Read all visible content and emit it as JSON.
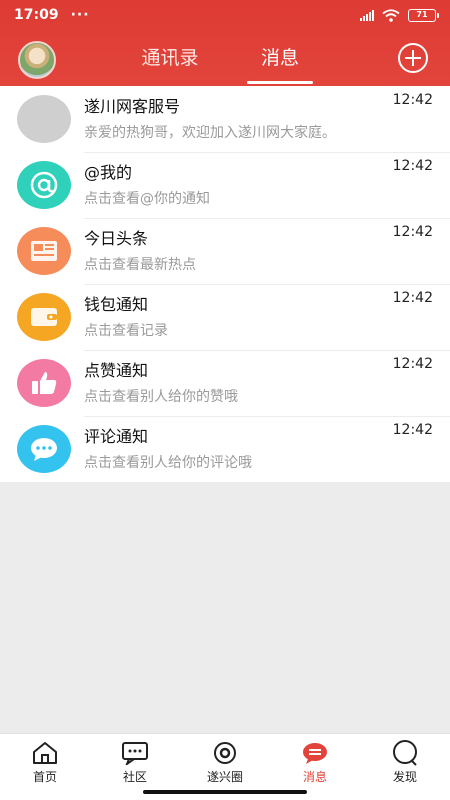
{
  "status_bar": {
    "time": "17:09",
    "dots": "···",
    "battery": "71"
  },
  "header": {
    "tabs": [
      {
        "label": "通讯录",
        "active": false
      },
      {
        "label": "消息",
        "active": true
      }
    ]
  },
  "messages": [
    {
      "title": "遂川网客服号",
      "subtitle": "亲爱的热狗哥，欢迎加入遂川网大家庭。",
      "time": "12:42",
      "icon": "avatar-placeholder"
    },
    {
      "title": "@我的",
      "subtitle": "点击查看@你的通知",
      "time": "12:42",
      "icon": "at-icon"
    },
    {
      "title": "今日头条",
      "subtitle": "点击查看最新热点",
      "time": "12:42",
      "icon": "newspaper-icon"
    },
    {
      "title": "钱包通知",
      "subtitle": "点击查看记录",
      "time": "12:42",
      "icon": "wallet-icon"
    },
    {
      "title": "点赞通知",
      "subtitle": "点击查看别人给你的赞哦",
      "time": "12:42",
      "icon": "thumbs-up-icon"
    },
    {
      "title": "评论通知",
      "subtitle": "点击查看别人给你的评论哦",
      "time": "12:42",
      "icon": "comment-icon"
    }
  ],
  "bottom_nav": [
    {
      "label": "首页",
      "icon": "home-icon",
      "active": false
    },
    {
      "label": "社区",
      "icon": "community-icon",
      "active": false
    },
    {
      "label": "遂兴圈",
      "icon": "circle-icon",
      "active": false
    },
    {
      "label": "消息",
      "icon": "message-icon",
      "active": true
    },
    {
      "label": "发现",
      "icon": "discover-icon",
      "active": false
    }
  ],
  "colors": {
    "brand": "#e2443b",
    "background": "#ececec"
  }
}
